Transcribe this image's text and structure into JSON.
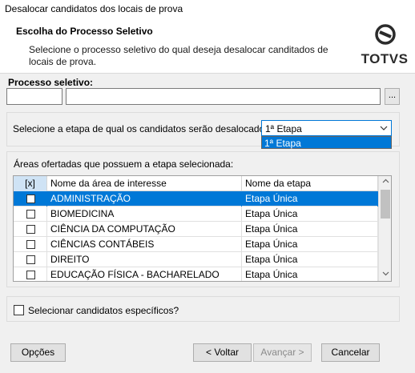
{
  "window": {
    "title": "Desalocar candidatos dos locais de prova"
  },
  "header": {
    "title": "Escolha do Processo Seletivo",
    "description": "Selecione o processo seletivo do qual deseja desalocar canditados de locais de prova.",
    "logo_text": "TOTVS"
  },
  "process": {
    "label": "Processo seletivo:",
    "code_value": "",
    "name_value": "",
    "browse_label": "..."
  },
  "stage": {
    "label": "Selecione a etapa de qual os candidatos serão desalocados:",
    "selected": "1ª Etapa",
    "options": [
      "1ª Etapa"
    ]
  },
  "areas": {
    "label": "Áreas ofertadas que possuem a etapa selecionada:",
    "columns": [
      "[x]",
      "Nome da área de interesse",
      "Nome da etapa"
    ],
    "rows": [
      {
        "checked": false,
        "name": "ADMINISTRAÇÃO",
        "stage": "Etapa Única",
        "selected": true
      },
      {
        "checked": false,
        "name": "BIOMEDICINA",
        "stage": "Etapa Única",
        "selected": false
      },
      {
        "checked": false,
        "name": "CIÊNCIA DA COMPUTAÇÃO",
        "stage": "Etapa Única",
        "selected": false
      },
      {
        "checked": false,
        "name": "CIÊNCIAS CONTÁBEIS",
        "stage": "Etapa Única",
        "selected": false
      },
      {
        "checked": false,
        "name": "DIREITO",
        "stage": "Etapa Única",
        "selected": false
      },
      {
        "checked": false,
        "name": "EDUCAÇÃO FÍSICA - BACHARELADO",
        "stage": "Etapa Única",
        "selected": false
      }
    ]
  },
  "specific": {
    "label": "Selecionar candidatos específicos?",
    "checked": false
  },
  "buttons": {
    "options": "Opções",
    "back": "< Voltar",
    "next": "Avançar >",
    "cancel": "Cancelar"
  }
}
